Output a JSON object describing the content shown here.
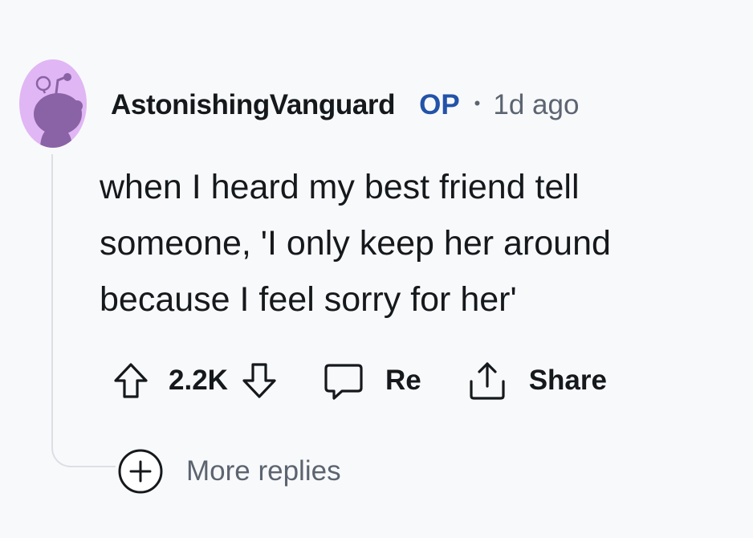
{
  "comment": {
    "author": "AstonishingVanguard",
    "op_badge": "OP",
    "separator": "•",
    "timestamp": "1d ago",
    "body": "when I heard my best friend tell someone, 'I only keep her around because I feel sorry for her'",
    "avatar_icon": "reddit-snoo-avatar",
    "avatar_color": "#e1b6f4"
  },
  "actions": {
    "upvote_icon": "upvote-arrow-icon",
    "vote_count": "2.2K",
    "downvote_icon": "downvote-arrow-icon",
    "reply_icon": "speech-bubble-icon",
    "reply_label": "Re",
    "share_icon": "share-upload-icon",
    "share_label": "Share"
  },
  "more_replies": {
    "icon": "plus-circle-icon",
    "label": "More replies"
  }
}
